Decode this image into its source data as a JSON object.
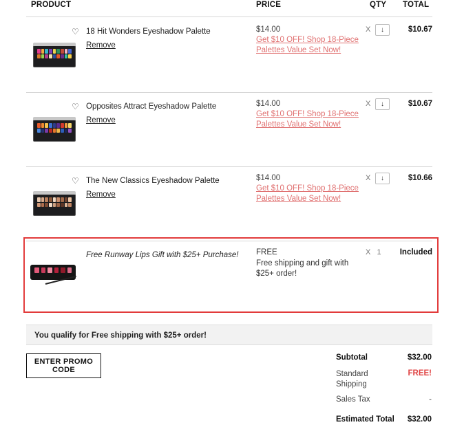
{
  "header": {
    "product": "PRODUCT",
    "price": "PRICE",
    "qty": "QTY",
    "total": "TOTAL"
  },
  "items": [
    {
      "name": "18 Hit Wonders Eyeshadow Palette",
      "remove": "Remove",
      "price": "$14.00",
      "promo": "Get $10 OFF! Shop 18-Piece Palettes Value Set Now!",
      "qty_x": "X",
      "qty_arrow": "↓",
      "total": "$10.67",
      "swatches": [
        "#e63e8e",
        "#f4a742",
        "#3bb5c9",
        "#7b3fb8",
        "#e8d44f",
        "#2f8f5a",
        "#c24a3a",
        "#f2b6c6",
        "#4766d1",
        "#d97a2a",
        "#9bd44f",
        "#b23e8c",
        "#f0e1b0",
        "#2a4f9e",
        "#e3562c",
        "#6c2d8a",
        "#33c2a4",
        "#f7d04b"
      ]
    },
    {
      "name": "Opposites Attract Eyeshadow Palette",
      "remove": "Remove",
      "price": "$14.00",
      "promo": "Get $10 OFF! Shop 18-Piece Palettes Value Set Now!",
      "qty_x": "X",
      "qty_arrow": "↓",
      "total": "$10.67",
      "swatches": [
        "#e85a2a",
        "#f08a2e",
        "#f6c24a",
        "#3a6fd1",
        "#2d3b8a",
        "#5b2c8f",
        "#d43a2e",
        "#f29a3a",
        "#f5d66a",
        "#4a86e0",
        "#233170",
        "#7a3aa8",
        "#b82a22",
        "#e6772a",
        "#f1b64a",
        "#2c5db8",
        "#1b2458",
        "#8f4fc0"
      ]
    },
    {
      "name": "The New Classics Eyeshadow Palette",
      "remove": "Remove",
      "price": "$14.00",
      "promo": "Get $10 OFF! Shop 18-Piece Palettes Value Set Now!",
      "qty_x": "X",
      "qty_arrow": "↓",
      "total": "$10.66",
      "swatches": [
        "#e8c9b0",
        "#d7a98a",
        "#b9805e",
        "#8e5a3c",
        "#f0d8c2",
        "#c98f6e",
        "#a26a4a",
        "#6e4330",
        "#eac2a2",
        "#d39a78",
        "#b07050",
        "#7c4a32",
        "#f2dcc8",
        "#cfa080",
        "#9e6446",
        "#5e3626",
        "#e2b898",
        "#c08462"
      ]
    }
  ],
  "gift": {
    "name": "Free Runway Lips Gift with $25+ Purchase!",
    "price": "FREE",
    "note": "Free shipping and gift with $25+ order!",
    "qty_x": "X",
    "qty": "1",
    "total": "Included",
    "swatches": [
      "#e25b7a",
      "#c83a5a",
      "#f08aa0",
      "#b21f3a",
      "#8e1a2a",
      "#d96a88"
    ]
  },
  "banner": "You qualify for Free shipping with $25+ order!",
  "promo_button": "ENTER PROMO CODE",
  "summary": {
    "subtotal_label": "Subtotal",
    "subtotal": "$32.00",
    "shipping_label": "Standard Shipping",
    "shipping": "FREE!",
    "tax_label": "Sales Tax",
    "tax": "-",
    "estimated_label": "Estimated Total",
    "estimated": "$32.00"
  },
  "colors": {
    "accent_link": "#e07070",
    "highlight_border": "#e23b3b",
    "free_text": "#e04444"
  }
}
